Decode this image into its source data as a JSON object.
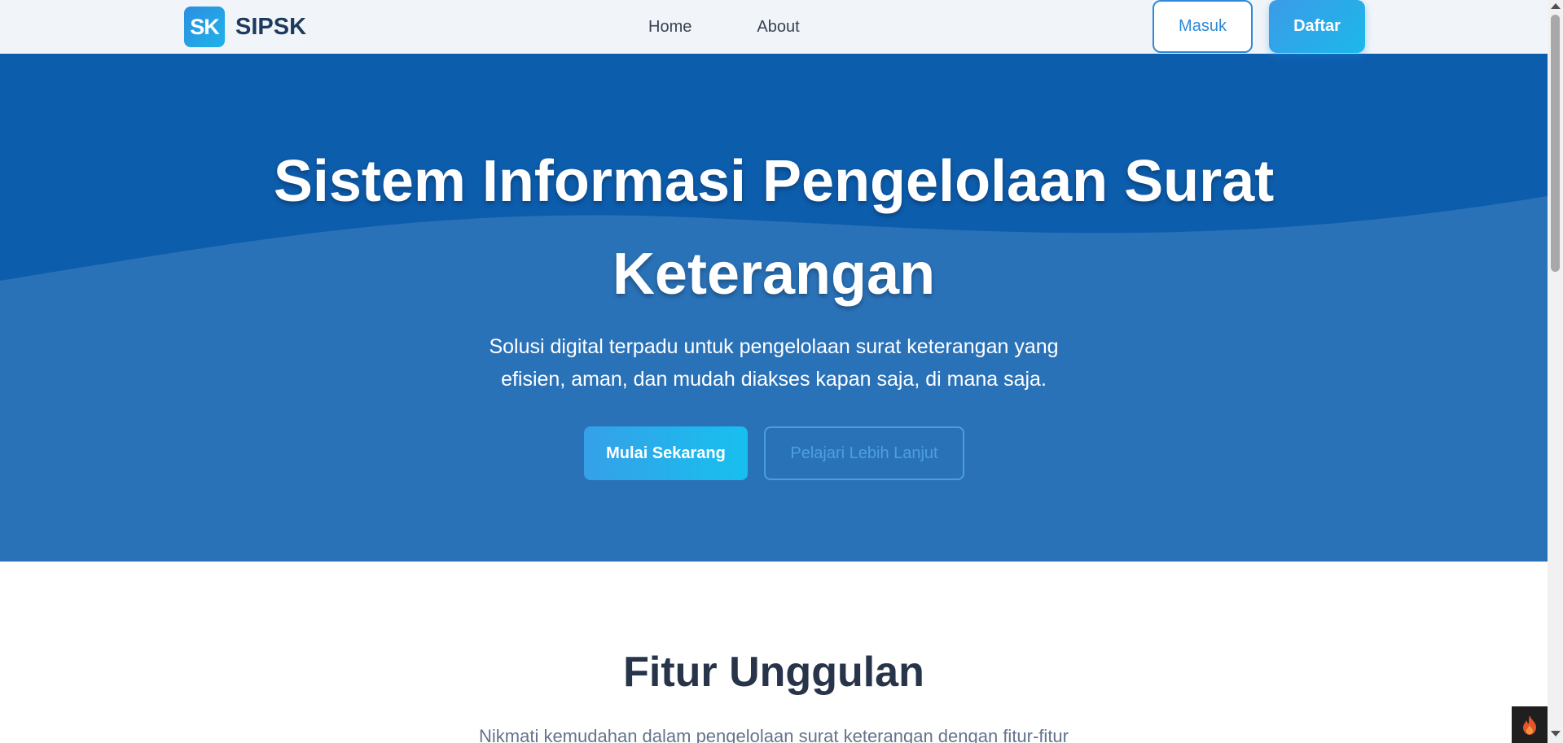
{
  "brand": {
    "badge": "SK",
    "name": "SIPSK"
  },
  "nav": {
    "items": [
      {
        "label": "Home"
      },
      {
        "label": "About"
      }
    ]
  },
  "auth": {
    "login_label": "Masuk",
    "register_label": "Daftar"
  },
  "hero": {
    "title": "Sistem Informasi Pengelolaan Surat Keterangan",
    "subtitle": "Solusi digital terpadu untuk pengelolaan surat keterangan yang efisien, aman, dan mudah diakses kapan saja, di mana saja.",
    "primary_cta": "Mulai Sekarang",
    "secondary_cta": "Pelajari Lebih Lanjut"
  },
  "features": {
    "title": "Fitur Unggulan",
    "subtitle": "Nikmati kemudahan dalam pengelolaan surat keterangan dengan fitur-fitur"
  },
  "colors": {
    "hero_dark": "#0d5dad",
    "hero_light": "#2a72b8",
    "accent": "#1fb2ea",
    "heading": "#273449"
  },
  "icons": {
    "debug": "flame-icon"
  }
}
